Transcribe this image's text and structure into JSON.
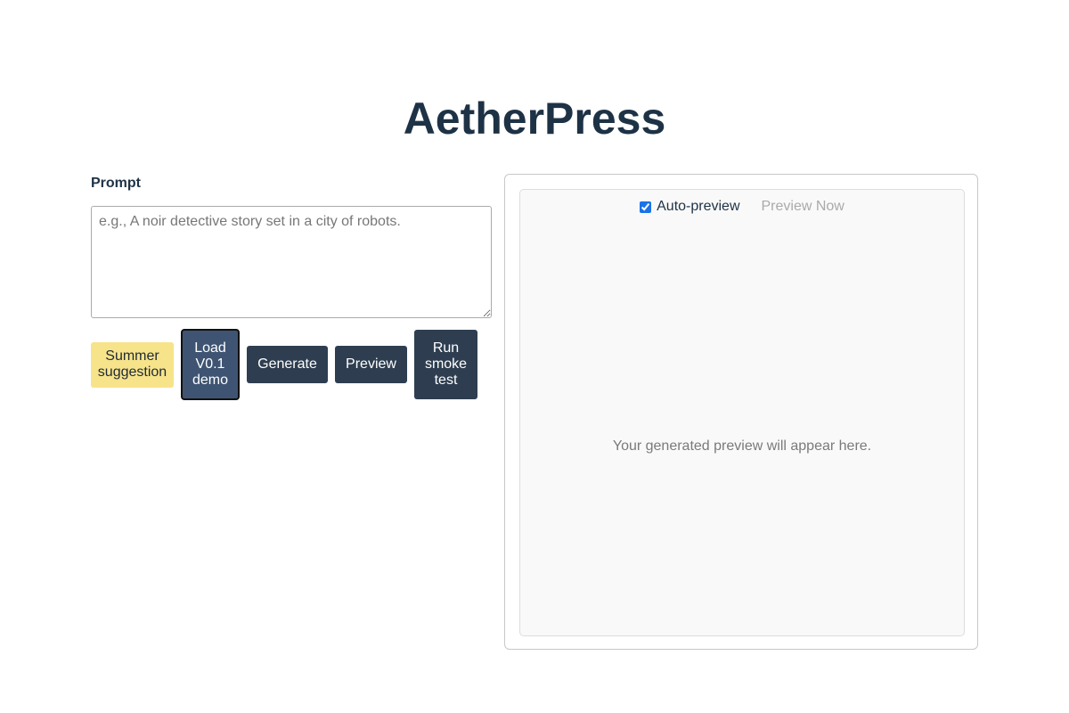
{
  "app": {
    "title": "AetherPress"
  },
  "prompt": {
    "label": "Prompt",
    "value": "",
    "placeholder": "e.g., A noir detective story set in a city of robots."
  },
  "buttons": {
    "summer_suggestion": "Summer suggestion",
    "load_demo": "Load V0.1 demo",
    "generate": "Generate",
    "preview": "Preview",
    "run_smoke_test": "Run smoke test"
  },
  "preview_panel": {
    "auto_preview_label": "Auto-preview",
    "auto_preview_checked": true,
    "preview_now_label": "Preview Now",
    "preview_now_enabled": false,
    "placeholder": "Your generated preview will appear here."
  },
  "colors": {
    "title": "#1e3246",
    "button_dark": "#2e3e50",
    "button_demo": "#3e5472",
    "button_yellow": "#f7e38a",
    "preview_bg": "#f9f9f9"
  }
}
